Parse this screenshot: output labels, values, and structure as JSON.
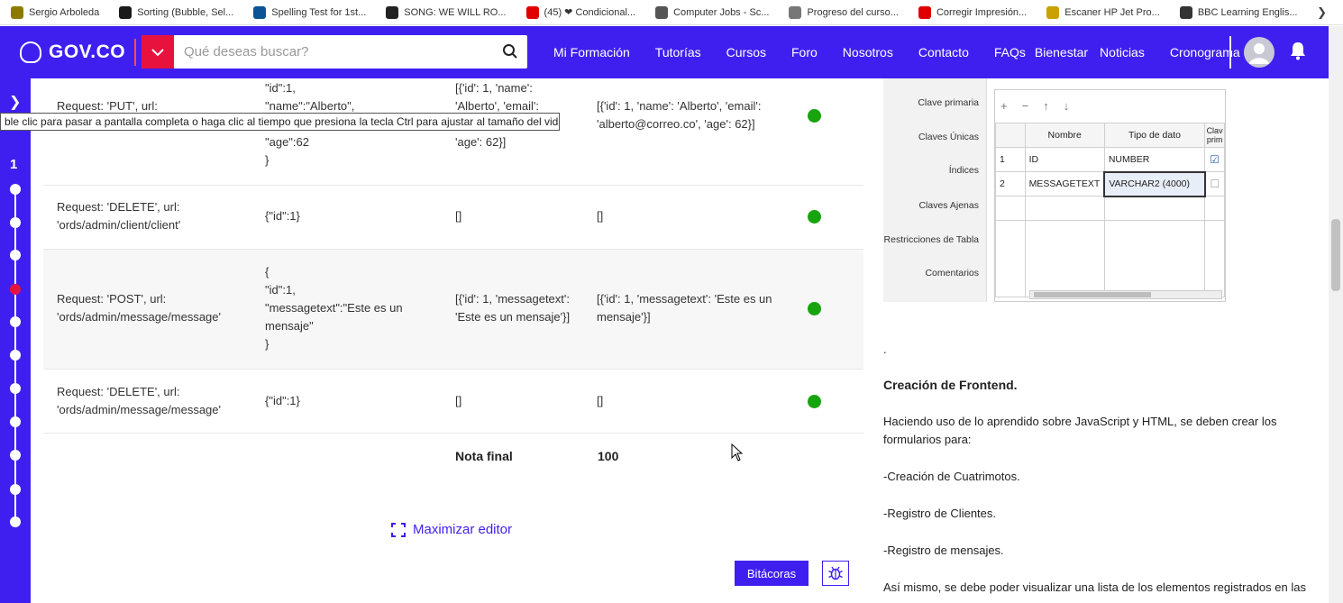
{
  "bookmarks": [
    {
      "label": "Sergio Arboleda",
      "color": "#8c7a00"
    },
    {
      "label": "Sorting (Bubble, Sel...",
      "color": "#1a1a1a"
    },
    {
      "label": "Spelling Test for 1st...",
      "color": "#0b5394"
    },
    {
      "label": "SONG: WE WILL RO...",
      "color": "#222222"
    },
    {
      "label": "(45) ❤ Condicional...",
      "color": "#e00000"
    },
    {
      "label": "Computer Jobs - Sc...",
      "color": "#555555"
    },
    {
      "label": "Progreso del curso...",
      "color": "#777777"
    },
    {
      "label": "Corregir Impresión...",
      "color": "#e00000"
    },
    {
      "label": "Escaner HP Jet Pro...",
      "color": "#c9a200"
    },
    {
      "label": "BBC Learning Englis...",
      "color": "#333333"
    }
  ],
  "header": {
    "logo_text": "GOV.CO",
    "search_placeholder": "Qué deseas buscar?",
    "nav": [
      "Mi Formación",
      "Tutorías",
      "Cursos",
      "Foro",
      "Nosotros",
      "Contacto",
      "FAQs",
      "Bienestar",
      "Noticias",
      "Cronograma"
    ]
  },
  "rail": {
    "current_step": "1"
  },
  "tooltip": "ble clic para pasar a pantalla completa o haga clic al tiempo que presiona la tecla Ctrl para ajustar al tamaño del video",
  "table": {
    "rows": [
      {
        "request": [
          "Request: 'PUT', url:"
        ],
        "body": [
          "\"id\":1,",
          "\"name\":\"Alberto\",",
          "",
          "\"age\":62",
          "}"
        ],
        "expected": [
          "[{'id': 1, 'name':",
          "'Alberto', 'email':",
          "",
          "'age': 62}]"
        ],
        "obtained": [
          "[{'id': 1, 'name': 'Alberto', 'email':",
          "'alberto@correo.co', 'age': 62}]"
        ],
        "status": "ok"
      },
      {
        "request": [
          "Request: 'DELETE', url:",
          "'ords/admin/client/client'"
        ],
        "body": [
          "{\"id\":1}"
        ],
        "expected": [
          "[]"
        ],
        "obtained": [
          "[]"
        ],
        "status": "ok"
      },
      {
        "request": [
          "Request: 'POST', url:",
          "'ords/admin/message/message'"
        ],
        "body": [
          "{",
          "\"id\":1,",
          "\"messagetext\":\"Este es un",
          "mensaje\"",
          "}"
        ],
        "expected": [
          "[{'id': 1, 'messagetext':",
          "'Este es un mensaje'}]"
        ],
        "obtained": [
          "[{'id': 1, 'messagetext': 'Este es un",
          "mensaje'}]"
        ],
        "status": "ok"
      },
      {
        "request": [
          "Request: 'DELETE', url:",
          "'ords/admin/message/message'"
        ],
        "body": [
          "{\"id\":1}"
        ],
        "expected": [
          "[]"
        ],
        "obtained": [
          "[]"
        ],
        "status": "ok"
      }
    ],
    "final_label": "Nota final",
    "final_value": "100"
  },
  "maximize_label": "Maximizar editor",
  "bitacoras_label": "Bitácoras",
  "db_panel": {
    "side_labels": [
      "Clave primaria",
      "Claves Únicas",
      "Índices",
      "Claves Ajenas",
      "Restricciones de Tabla",
      "Comentarios"
    ],
    "columns": [
      "",
      "Nombre",
      "Tipo de dato",
      "Clav prim"
    ],
    "rows": [
      {
        "num": "1",
        "name": "ID",
        "type": "NUMBER",
        "checked": true
      },
      {
        "num": "2",
        "name": "MESSAGETEXT",
        "type": "VARCHAR2 (4000)",
        "checked": false
      }
    ]
  },
  "right_text": {
    "dot": ".",
    "heading": "Creación de Frontend.",
    "intro": "Haciendo uso de lo aprendido sobre JavaScript y HTML, se deben crear los formularios para:",
    "items": [
      "-Creación de Cuatrimotos.",
      "-Registro de Clientes.",
      "-Registro de mensajes."
    ],
    "outro": "Así mismo, se debe poder visualizar una lista de los elementos registrados en las"
  },
  "colors": {
    "primary": "#3f1ff0",
    "accent": "#e8123f",
    "success": "#17a40f"
  }
}
